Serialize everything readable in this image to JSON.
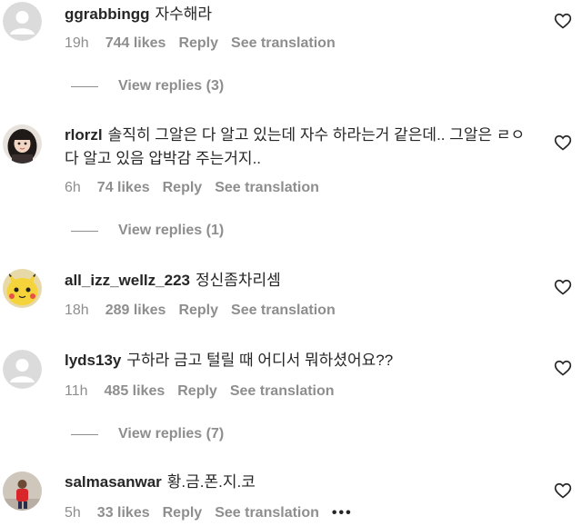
{
  "labels": {
    "reply": "Reply",
    "see_translation": "See translation",
    "more": "•••"
  },
  "comments": [
    {
      "username": "ggrabbingg",
      "text": "자수해라",
      "time": "19h",
      "likes": "744 likes",
      "avatar": "default-avatar",
      "view_replies": "View replies (3)"
    },
    {
      "username": "rlorzl",
      "text": "솔직히 그알은 다 알고 있는데 자수 하라는거 같은데.. 그알은 ㄹㅇ 다 알고 있음 압박감 주는거지..",
      "time": "6h",
      "likes": "74 likes",
      "avatar": "girl-avatar",
      "view_replies": "View replies (1)"
    },
    {
      "username": "all_izz_wellz_223",
      "text": "정신좀차리셈",
      "time": "18h",
      "likes": "289 likes",
      "avatar": "pikachu-avatar"
    },
    {
      "username": "lyds13y",
      "text": "구하라 금고 털릴 때 어디서 뭐하셨어요??",
      "time": "11h",
      "likes": "485 likes",
      "avatar": "default-avatar",
      "view_replies": "View replies (7)"
    },
    {
      "username": "salmasanwar",
      "text": "황.금.폰.지.코",
      "time": "5h",
      "likes": "33 likes",
      "avatar": "red-shirt-avatar",
      "show_more": true
    }
  ]
}
